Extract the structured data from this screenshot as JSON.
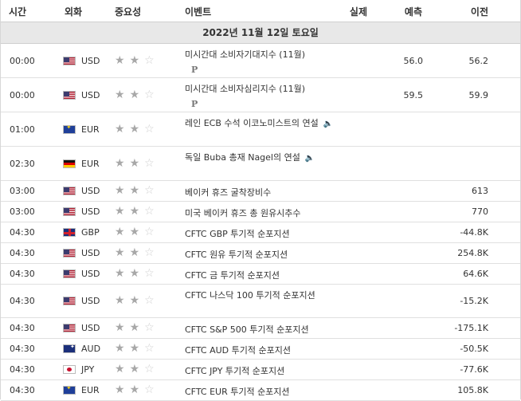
{
  "header": {
    "time": "시간",
    "currency": "외화",
    "importance": "중요성",
    "event": "이벤트",
    "actual": "실제",
    "forecast": "예측",
    "previous": "이전"
  },
  "date_label": "2022년 11월 12일 토요일",
  "rows": [
    {
      "time": "00:00",
      "flag": "us",
      "currency": "USD",
      "stars": 2,
      "event": "미시간대 소비자기대지수 (11월)",
      "badge": "P",
      "forecast": "56.0",
      "previous": "56.2"
    },
    {
      "time": "00:00",
      "flag": "us",
      "currency": "USD",
      "stars": 2,
      "event": "미시간대 소비자심리지수 (11월)",
      "badge": "P",
      "forecast": "59.5",
      "previous": "59.9"
    },
    {
      "time": "01:00",
      "flag": "eu",
      "currency": "EUR",
      "stars": 2,
      "event": "레인 ECB 수석 이코노미스트의 연설",
      "speech": true,
      "forecast": "",
      "previous": ""
    },
    {
      "time": "02:30",
      "flag": "de",
      "currency": "EUR",
      "stars": 2,
      "event": "독일 Buba 총재 Nagel의 연설",
      "speech": true,
      "forecast": "",
      "previous": ""
    },
    {
      "time": "03:00",
      "flag": "us",
      "currency": "USD",
      "stars": 2,
      "event": "베이커 휴즈 굴착장비수",
      "forecast": "",
      "previous": "613"
    },
    {
      "time": "03:00",
      "flag": "us",
      "currency": "USD",
      "stars": 2,
      "event": "미국 베이커 휴즈 총 원유시추수",
      "forecast": "",
      "previous": "770"
    },
    {
      "time": "04:30",
      "flag": "gb",
      "currency": "GBP",
      "stars": 2,
      "event": "CFTC GBP 투기적 순포지션",
      "forecast": "",
      "previous": "-44.8K"
    },
    {
      "time": "04:30",
      "flag": "us",
      "currency": "USD",
      "stars": 2,
      "event": "CFTC 원유 투기적 순포지션",
      "forecast": "",
      "previous": "254.8K"
    },
    {
      "time": "04:30",
      "flag": "us",
      "currency": "USD",
      "stars": 2,
      "event": "CFTC 금 투기적 순포지션",
      "forecast": "",
      "previous": "64.6K"
    },
    {
      "time": "04:30",
      "flag": "us",
      "currency": "USD",
      "stars": 2,
      "event": "CFTC 나스닥 100 투기적 순포지션",
      "forecast": "",
      "previous": "-15.2K"
    },
    {
      "time": "04:30",
      "flag": "us",
      "currency": "USD",
      "stars": 2,
      "event": "CFTC S&P 500 투기적 순포지션",
      "forecast": "",
      "previous": "-175.1K"
    },
    {
      "time": "04:30",
      "flag": "au",
      "currency": "AUD",
      "stars": 2,
      "event": "CFTC AUD 투기적 순포지션",
      "forecast": "",
      "previous": "-50.5K"
    },
    {
      "time": "04:30",
      "flag": "jp",
      "currency": "JPY",
      "stars": 2,
      "event": "CFTC JPY 투기적 순포지션",
      "forecast": "",
      "previous": "-77.6K"
    },
    {
      "time": "04:30",
      "flag": "eu",
      "currency": "EUR",
      "stars": 2,
      "event": "CFTC EUR 투기적 순포지션",
      "forecast": "",
      "previous": "105.8K"
    }
  ]
}
